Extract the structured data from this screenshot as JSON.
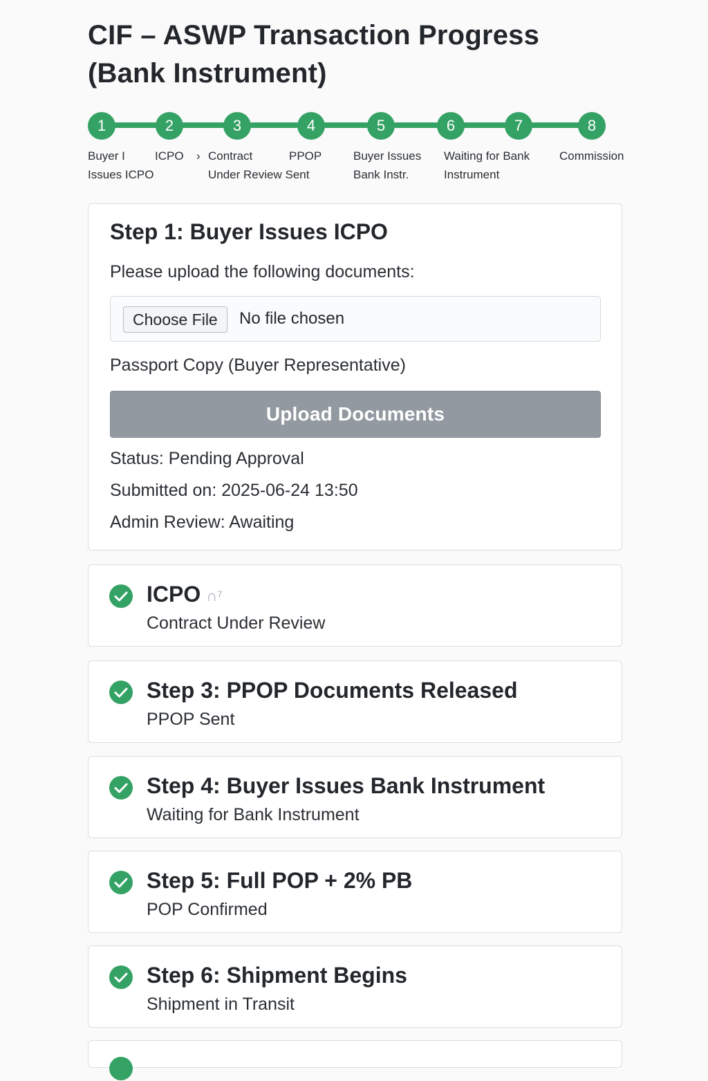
{
  "page": {
    "title": "CIF – ASWP Transaction Progress (Bank Instrument)"
  },
  "colors": {
    "accent_green": "#35a265",
    "button_disabled": "#9299a0",
    "card_border": "#d9dde1"
  },
  "stepper": {
    "steps": [
      {
        "number": "1",
        "label_line1": "Buyer I",
        "label_line2": "Issues ICPO"
      },
      {
        "number": "2",
        "label_line1": "ICPO",
        "label_line2": ""
      },
      {
        "number": "3",
        "label_line1": "Contract",
        "label_line2": "Under Review Sent"
      },
      {
        "number": "4",
        "label_line1": "PPOP",
        "label_line2": ""
      },
      {
        "number": "5",
        "label_line1": "Buyer Issues",
        "label_line2": "Bank Instr."
      },
      {
        "number": "6",
        "label_line1": "Waiting for Bank",
        "label_line2": "Instrument"
      },
      {
        "number": "7",
        "label_line1": "",
        "label_line2": ""
      },
      {
        "number": "8",
        "label_line1": "Commission",
        "label_line2": ""
      }
    ]
  },
  "current_step": {
    "title": "Step 1: Buyer Issues ICPO",
    "instructions": "Please upload the following documents:",
    "file_button": "Choose File",
    "file_status": "No file chosen",
    "document_label": "Passport Copy (Buyer Representative)",
    "upload_button": "Upload Documents",
    "status": "Status: Pending Approval",
    "submitted": "Submitted on: 2025-06-24 13:50",
    "admin_review": "Admin Review: Awaiting"
  },
  "completed_steps": [
    {
      "title": "ICPO",
      "subtitle": "Contract Under Review",
      "icon": "check-circle-icon"
    },
    {
      "title": "Step 3: PPOP Documents Released",
      "subtitle": "PPOP Sent",
      "icon": "check-circle-icon"
    },
    {
      "title": "Step 4: Buyer Issues Bank Instrument",
      "subtitle": "Waiting for Bank Instrument",
      "icon": "check-circle-icon"
    },
    {
      "title": "Step 5: Full POP + 2% PB",
      "subtitle": "POP Confirmed",
      "icon": "check-circle-icon"
    },
    {
      "title": "Step 6: Shipment Begins",
      "subtitle": "Shipment in Transit",
      "icon": "check-circle-icon"
    }
  ]
}
